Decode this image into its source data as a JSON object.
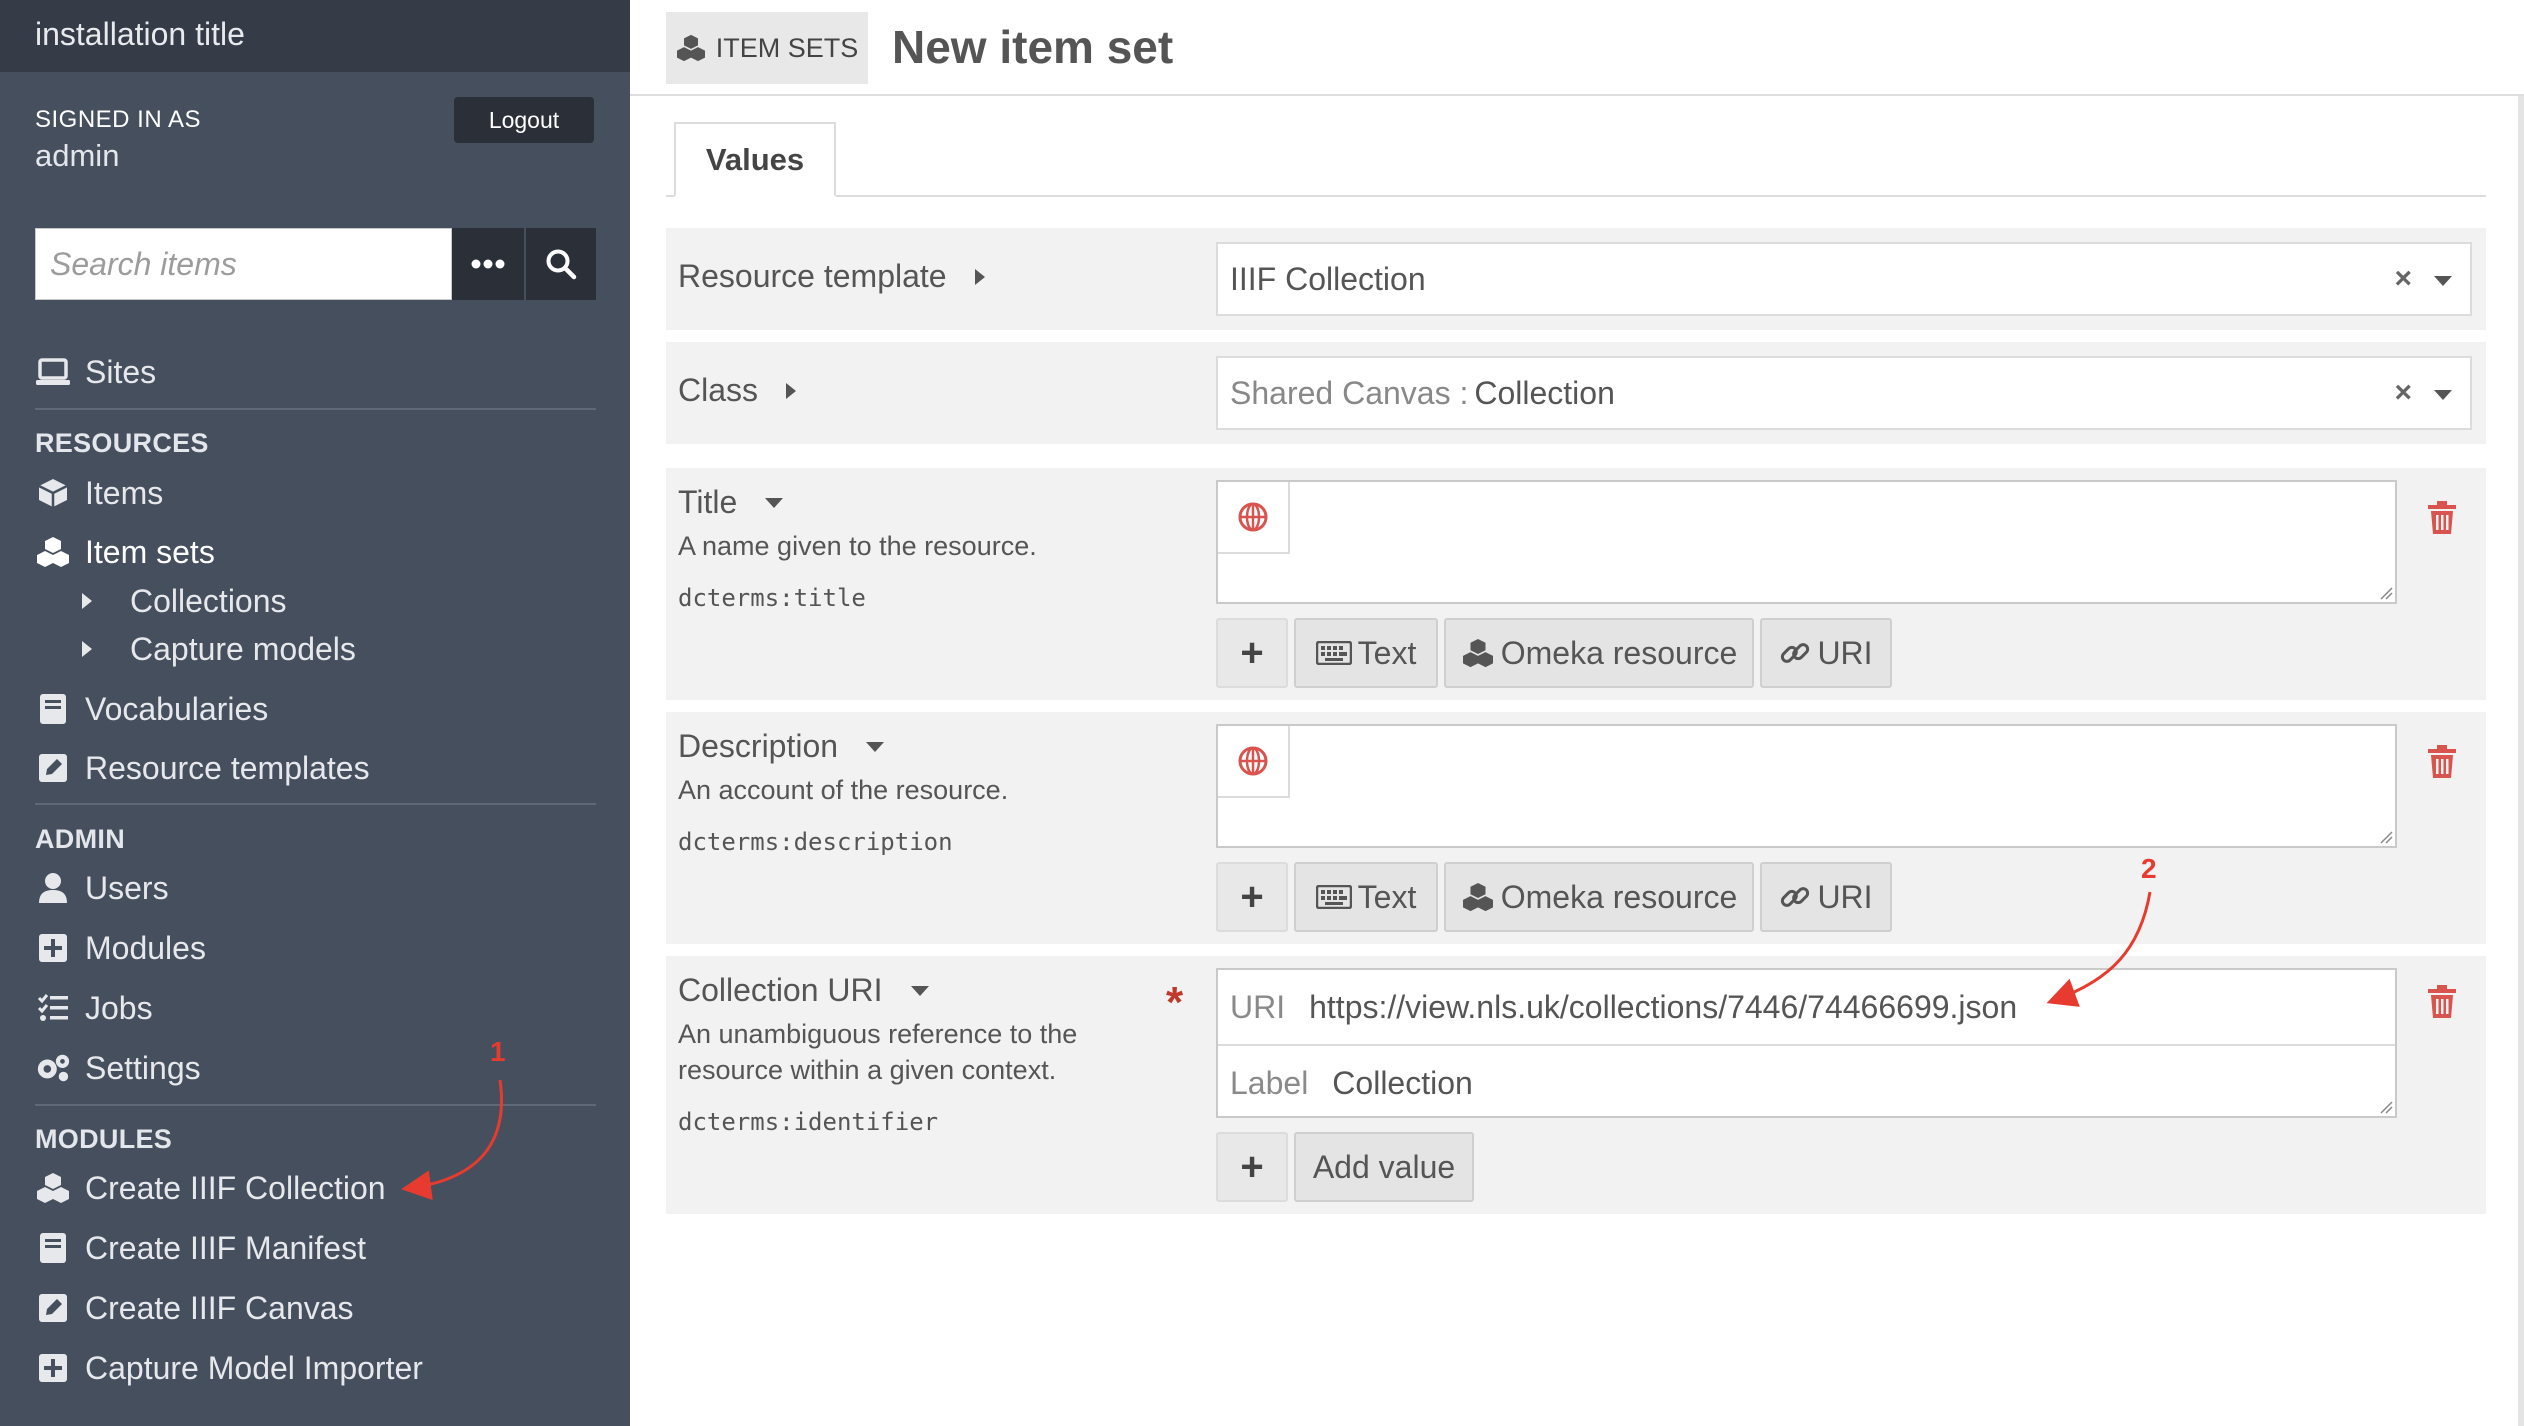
{
  "app": {
    "installation_title": "installation title"
  },
  "user": {
    "signed_in_label": "SIGNED IN AS",
    "username": "admin",
    "logout_label": "Logout"
  },
  "search": {
    "placeholder": "Search items"
  },
  "nav": {
    "sites": "Sites",
    "resources_heading": "RESOURCES",
    "items": "Items",
    "item_sets": "Item sets",
    "collections": "Collections",
    "capture_models": "Capture models",
    "vocabularies": "Vocabularies",
    "resource_templates": "Resource templates",
    "admin_heading": "ADMIN",
    "users": "Users",
    "modules": "Modules",
    "jobs": "Jobs",
    "settings": "Settings",
    "modules_heading": "MODULES",
    "create_iiif_collection": "Create IIIF Collection",
    "create_iiif_manifest": "Create IIIF Manifest",
    "create_iiif_canvas": "Create IIIF Canvas",
    "capture_model_importer": "Capture Model Importer"
  },
  "header": {
    "breadcrumb": "ITEM SETS",
    "title": "New item set"
  },
  "tabs": {
    "values": "Values"
  },
  "form": {
    "resource_template": {
      "label": "Resource template",
      "value": "IIIF Collection"
    },
    "class": {
      "label": "Class",
      "prefix": "Shared Canvas :",
      "value": "Collection"
    },
    "title": {
      "label": "Title",
      "description": "A name given to the resource.",
      "term": "dcterms:title"
    },
    "description": {
      "label": "Description",
      "description": "An account of the resource.",
      "term": "dcterms:description"
    },
    "collection_uri": {
      "label": "Collection URI",
      "description": "An unambiguous reference to the resource within a given context.",
      "term": "dcterms:identifier",
      "uri_label": "URI",
      "uri_value": "https://view.nls.uk/collections/7446/74466699.json",
      "label_label": "Label",
      "label_value": "Collection",
      "required_mark": "*"
    },
    "buttons": {
      "text": "Text",
      "omeka_resource": "Omeka resource",
      "uri": "URI",
      "add_value": "Add value",
      "plus": "+"
    }
  },
  "annotations": {
    "one": "1",
    "two": "2"
  },
  "colors": {
    "sidebar_bg": "#464f5d",
    "sidebar_title_bg": "#353c47",
    "annotation_red": "#e63b2e",
    "trash_red": "#d9534f"
  }
}
